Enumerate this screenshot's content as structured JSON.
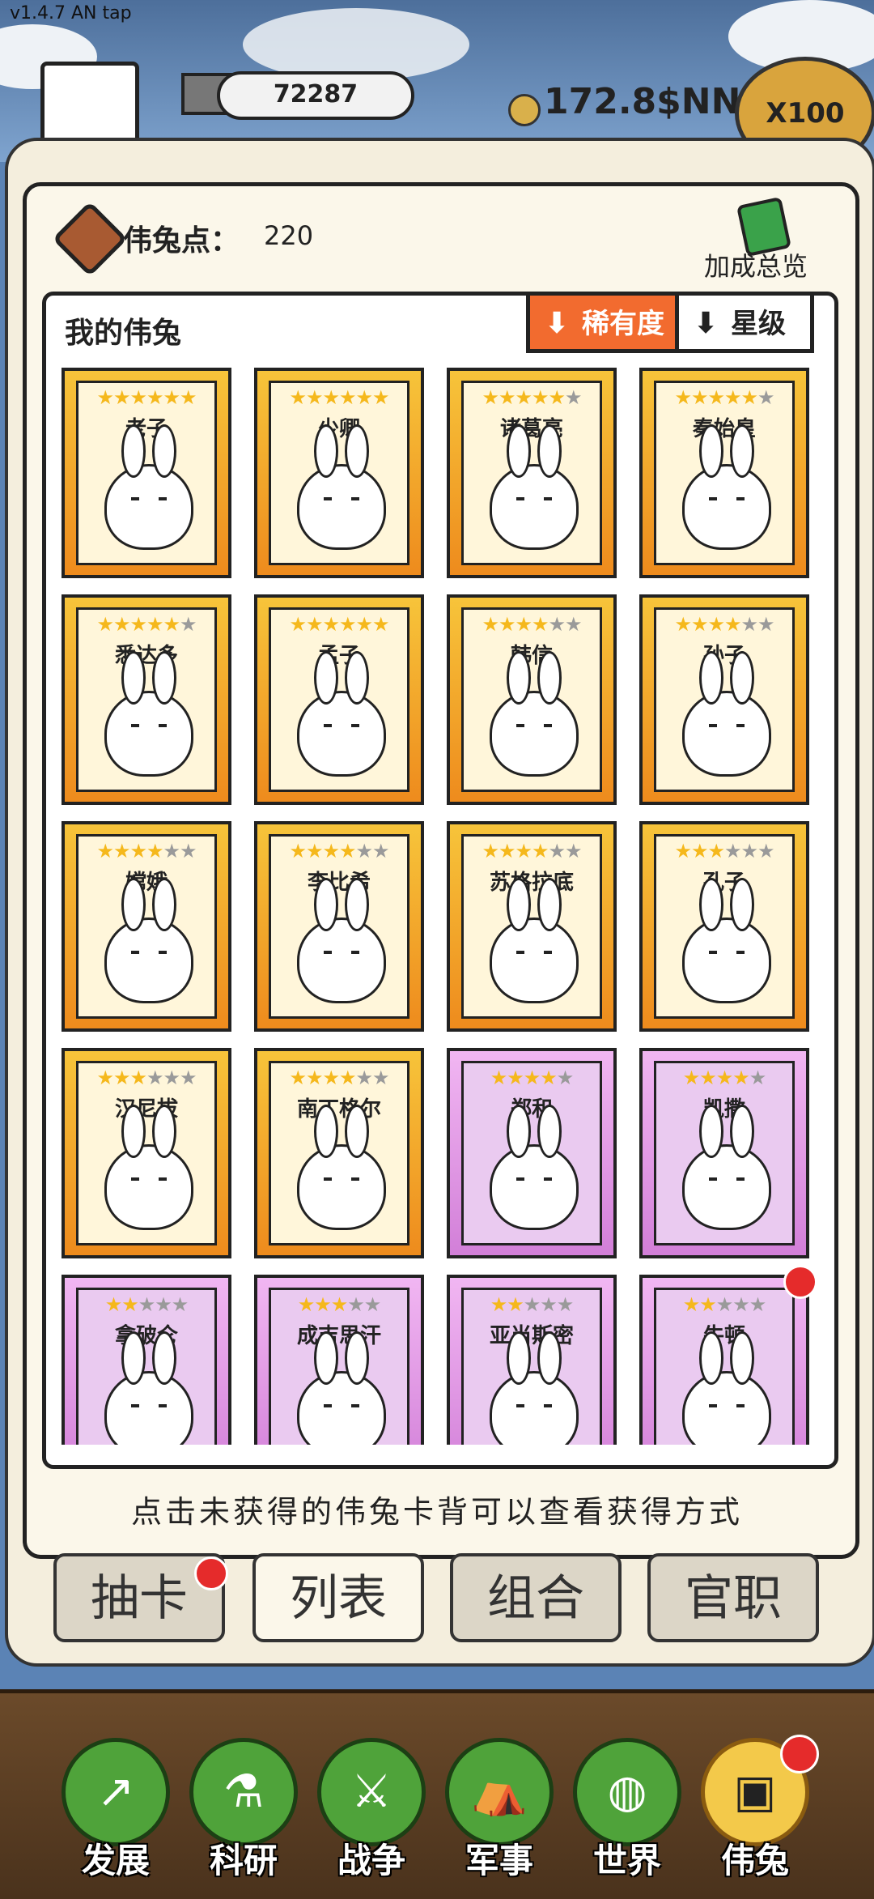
{
  "version": "v1.4.7 AN tap",
  "header": {
    "resource_value": "72287",
    "gold_value": "172.8$NN",
    "multiplier": "X100"
  },
  "panel": {
    "points_label": "伟兔点：",
    "points_value": "220",
    "bonus_label": "加成总览",
    "list_title": "我的伟兔",
    "sort_rarity": "稀有度",
    "sort_star": "星级"
  },
  "cards": [
    {
      "name": "老子",
      "stars": 6,
      "max": 6,
      "tier": "gold"
    },
    {
      "name": "少卿",
      "stars": 6,
      "max": 6,
      "tier": "gold"
    },
    {
      "name": "诸葛亮",
      "stars": 5,
      "max": 6,
      "tier": "gold"
    },
    {
      "name": "秦始皇",
      "stars": 5,
      "max": 6,
      "tier": "gold"
    },
    {
      "name": "悉达多",
      "stars": 5,
      "max": 6,
      "tier": "gold"
    },
    {
      "name": "孟子",
      "stars": 6,
      "max": 6,
      "tier": "gold"
    },
    {
      "name": "韩信",
      "stars": 4,
      "max": 6,
      "tier": "gold"
    },
    {
      "name": "孙子",
      "stars": 4,
      "max": 6,
      "tier": "gold"
    },
    {
      "name": "嫦娥",
      "stars": 4,
      "max": 6,
      "tier": "gold"
    },
    {
      "name": "李比希",
      "stars": 4,
      "max": 6,
      "tier": "gold"
    },
    {
      "name": "苏格拉底",
      "stars": 4,
      "max": 6,
      "tier": "gold"
    },
    {
      "name": "孔子",
      "stars": 3,
      "max": 6,
      "tier": "gold"
    },
    {
      "name": "汉尼拔",
      "stars": 3,
      "max": 6,
      "tier": "gold"
    },
    {
      "name": "南丁格尔",
      "stars": 4,
      "max": 6,
      "tier": "gold"
    },
    {
      "name": "郑和",
      "stars": 4,
      "max": 5,
      "tier": "purple"
    },
    {
      "name": "凯撒",
      "stars": 4,
      "max": 5,
      "tier": "purple"
    },
    {
      "name": "拿破仑",
      "stars": 2,
      "max": 5,
      "tier": "purple"
    },
    {
      "name": "成吉思汗",
      "stars": 3,
      "max": 5,
      "tier": "purple"
    },
    {
      "name": "亚当斯密",
      "stars": 2,
      "max": 5,
      "tier": "purple"
    },
    {
      "name": "牛顿",
      "stars": 2,
      "max": 5,
      "tier": "purple"
    }
  ],
  "hint": "点击未获得的伟兔卡背可以查看获得方式",
  "tabs": [
    "抽卡",
    "列表",
    "组合",
    "官职"
  ],
  "nav": [
    {
      "label": "发展",
      "icon": "develop-icon"
    },
    {
      "label": "科研",
      "icon": "flask-icon"
    },
    {
      "label": "战争",
      "icon": "swords-icon"
    },
    {
      "label": "军事",
      "icon": "military-icon"
    },
    {
      "label": "世界",
      "icon": "globe-icon"
    },
    {
      "label": "伟兔",
      "icon": "rabbit-card-icon"
    }
  ]
}
